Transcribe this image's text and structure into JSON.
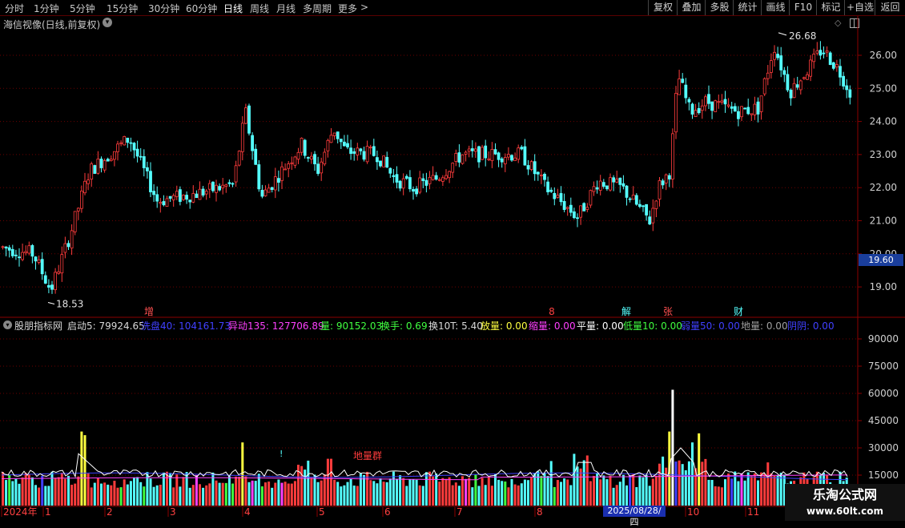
{
  "toolbar": {
    "periods": [
      "分时",
      "1分钟",
      "5分钟",
      "15分钟",
      "30分钟",
      "60分钟",
      "日线",
      "周线",
      "月线",
      "多周期",
      "更多"
    ],
    "active_period": "日线",
    "more_arrow": ">",
    "right_buttons": [
      "复权",
      "叠加",
      "多股",
      "统计",
      "画线",
      "F10",
      "标记",
      "+自选",
      "返回"
    ]
  },
  "main_chart": {
    "title": "海信视像(日线,前复权)",
    "price_axis_labels": [
      "26.00",
      "25.00",
      "24.00",
      "23.00",
      "22.00",
      "21.00",
      "20.00",
      "19.00"
    ],
    "current_price_tag": "19.60",
    "high_annotation": "26.68",
    "low_annotation": "18.53",
    "event_markers": [
      {
        "text": "增",
        "color": "#ff5050"
      },
      {
        "text": "8",
        "color": "#ff4040"
      },
      {
        "text": "解",
        "color": "#55ffff"
      },
      {
        "text": "张",
        "color": "#ff5050"
      },
      {
        "text": "财",
        "color": "#55ffff"
      }
    ],
    "up_color": "#ff3c3c",
    "down_color": "#54ffff"
  },
  "indicator": {
    "name": "股朋指标网",
    "items": [
      {
        "text": "启动5: 79924.65",
        "color": "#d8d8d8"
      },
      {
        "text": "洗盘40: 104161.73",
        "color": "#4040ff"
      },
      {
        "text": "异动135: 127706.89",
        "color": "#ff40ff"
      },
      {
        "text": "量: 90152.03",
        "color": "#40ff40"
      },
      {
        "text": "换手: 0.69",
        "color": "#40ff40"
      },
      {
        "text": "换10T: 5.40",
        "color": "#d8d8d8"
      },
      {
        "text": "放量: 0.00",
        "color": "#ffff40"
      },
      {
        "text": "缩量: 0.00",
        "color": "#ff40ff"
      },
      {
        "text": "平量: 0.00",
        "color": "#ffffff"
      },
      {
        "text": "低量10: 0.00",
        "color": "#40ff40"
      },
      {
        "text": "弱量50: 0.00",
        "color": "#4040ff"
      },
      {
        "text": "地量: 0.00",
        "color": "#a0a0a0"
      },
      {
        "text": "阴阴: 0.00",
        "color": "#4040ff"
      }
    ],
    "volume_axis_labels": [
      "90000",
      "75000",
      "60000",
      "45000",
      "30000",
      "15000"
    ],
    "annotation_text": "地量群",
    "annotation_mark": "!"
  },
  "time_axis": {
    "labels": [
      "2024年",
      "1",
      "2",
      "3",
      "4",
      "5",
      "6",
      "7",
      "8",
      "10",
      "11"
    ],
    "cursor_date": "2025/08/28/四"
  },
  "watermark": {
    "line1": "乐淘公式网",
    "line2": "www.60lt.com"
  }
}
